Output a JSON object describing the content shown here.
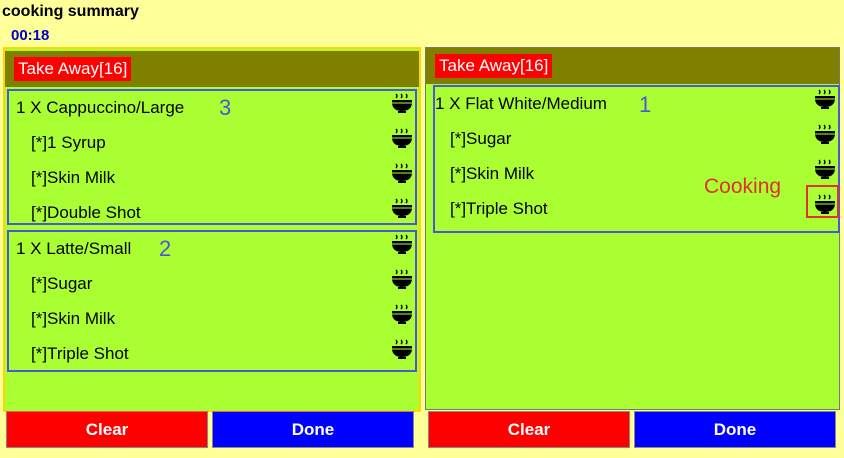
{
  "app": {
    "title": "cooking summary",
    "timer": "00:18"
  },
  "panels": [
    {
      "header": "Take Away[16]",
      "groups": [
        {
          "sequence": "3",
          "item": "1 X  Cappuccino/Large",
          "modifiers": [
            "[*]1 Syrup",
            "[*]Skin Milk",
            "[*]Double Shot"
          ]
        },
        {
          "sequence": "2",
          "item": "1 X  Latte/Small",
          "modifiers": [
            "[*]Sugar",
            "[*]Skin Milk",
            "[*]Triple Shot"
          ]
        }
      ],
      "clear_label": "Clear",
      "done_label": "Done"
    },
    {
      "header": "Take Away[16]",
      "groups": [
        {
          "sequence": "1",
          "item": "1 X  Flat White/Medium",
          "modifiers": [
            "[*]Sugar",
            "[*]Skin Milk",
            "[*]Triple Shot"
          ]
        }
      ],
      "status": "Cooking",
      "clear_label": "Clear",
      "done_label": "Done"
    }
  ],
  "icons": {
    "row_status": "cooking-bowl-icon"
  },
  "colors": {
    "panel": "#AAFF33",
    "header": "#808000",
    "annotation": "#4F55D6",
    "cooking": "#E03030",
    "clear": "#FF0000",
    "done": "#0000FF"
  }
}
